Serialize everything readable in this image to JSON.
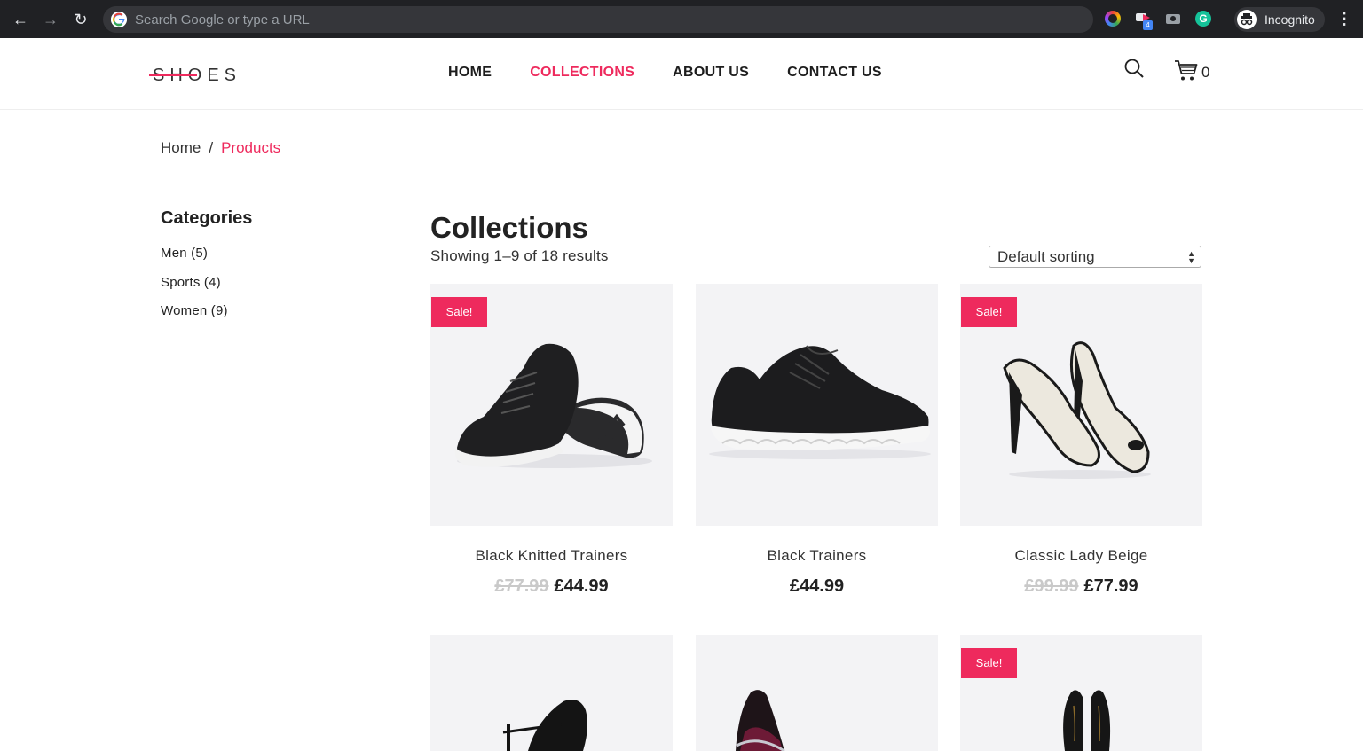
{
  "browser": {
    "omnibox_placeholder": "Search Google or type a URL",
    "incognito_label": "Incognito",
    "extension_badge": "4"
  },
  "site": {
    "logo": "SHOES",
    "nav": [
      {
        "label": "HOME",
        "active": false
      },
      {
        "label": "COLLECTIONS",
        "active": true
      },
      {
        "label": "ABOUT US",
        "active": false
      },
      {
        "label": "CONTACT US",
        "active": false
      }
    ],
    "cart_count": "0",
    "accent_color": "#ee2a5d"
  },
  "breadcrumb": {
    "home": "Home",
    "separator": "/",
    "current": "Products"
  },
  "sidebar": {
    "title": "Categories",
    "categories": [
      {
        "label": "Men (5)"
      },
      {
        "label": "Sports (4)"
      },
      {
        "label": "Women (9)"
      }
    ]
  },
  "main": {
    "title": "Collections",
    "result_count": "Showing 1–9 of 18 results",
    "sort": {
      "selected": "Default sorting"
    },
    "products": [
      {
        "name": "Black Knitted Trainers",
        "old_price": "£77.99",
        "price": "£44.99",
        "badge": "Sale!"
      },
      {
        "name": "Black Trainers",
        "old_price": "",
        "price": "£44.99",
        "badge": ""
      },
      {
        "name": "Classic Lady Beige",
        "old_price": "£99.99",
        "price": "£77.99",
        "badge": "Sale!"
      },
      {
        "name": "",
        "old_price": "",
        "price": "",
        "badge": ""
      },
      {
        "name": "",
        "old_price": "",
        "price": "",
        "badge": ""
      },
      {
        "name": "",
        "old_price": "",
        "price": "",
        "badge": "Sale!"
      }
    ]
  }
}
